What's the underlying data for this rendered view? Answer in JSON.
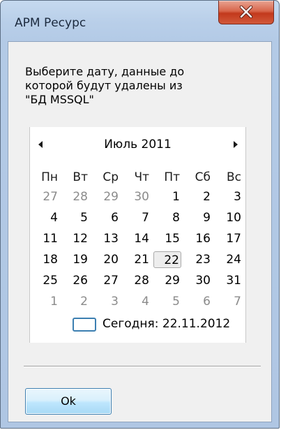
{
  "window": {
    "title": "АРМ Ресурс"
  },
  "dialog": {
    "prompt_line1": "Выберите дату, данные до",
    "prompt_line2": "которой будут удалены из",
    "prompt_line3": "\"БД MSSQL\"",
    "ok_label": "Ok"
  },
  "calendar": {
    "month_label": "Июль 2011",
    "weekdays": [
      "Пн",
      "Вт",
      "Ср",
      "Чт",
      "Пт",
      "Сб",
      "Вс"
    ],
    "weeks": [
      [
        {
          "d": "27",
          "other": true
        },
        {
          "d": "28",
          "other": true
        },
        {
          "d": "29",
          "other": true
        },
        {
          "d": "30",
          "other": true
        },
        {
          "d": "1"
        },
        {
          "d": "2"
        },
        {
          "d": "3"
        }
      ],
      [
        {
          "d": "4"
        },
        {
          "d": "5"
        },
        {
          "d": "6"
        },
        {
          "d": "7"
        },
        {
          "d": "8"
        },
        {
          "d": "9"
        },
        {
          "d": "10"
        }
      ],
      [
        {
          "d": "11"
        },
        {
          "d": "12"
        },
        {
          "d": "13"
        },
        {
          "d": "14"
        },
        {
          "d": "15"
        },
        {
          "d": "16"
        },
        {
          "d": "17"
        }
      ],
      [
        {
          "d": "18"
        },
        {
          "d": "19"
        },
        {
          "d": "20"
        },
        {
          "d": "21"
        },
        {
          "d": "22",
          "focused": true
        },
        {
          "d": "23"
        },
        {
          "d": "24"
        }
      ],
      [
        {
          "d": "25"
        },
        {
          "d": "26"
        },
        {
          "d": "27"
        },
        {
          "d": "28"
        },
        {
          "d": "29"
        },
        {
          "d": "30"
        },
        {
          "d": "31"
        }
      ],
      [
        {
          "d": "1",
          "other": true
        },
        {
          "d": "2",
          "other": true
        },
        {
          "d": "3",
          "other": true
        },
        {
          "d": "4",
          "other": true
        },
        {
          "d": "5",
          "other": true
        },
        {
          "d": "6",
          "other": true
        },
        {
          "d": "7",
          "other": true
        }
      ]
    ],
    "today_label": "Сегодня: 22.11.2012"
  },
  "icons": {
    "close": "close-icon",
    "prev": "triangle-left-icon",
    "next": "triangle-right-icon"
  },
  "colors": {
    "close_button": "#c2391c",
    "accent_border": "#3c7fb1",
    "other_month_text": "#8b8b8b"
  }
}
